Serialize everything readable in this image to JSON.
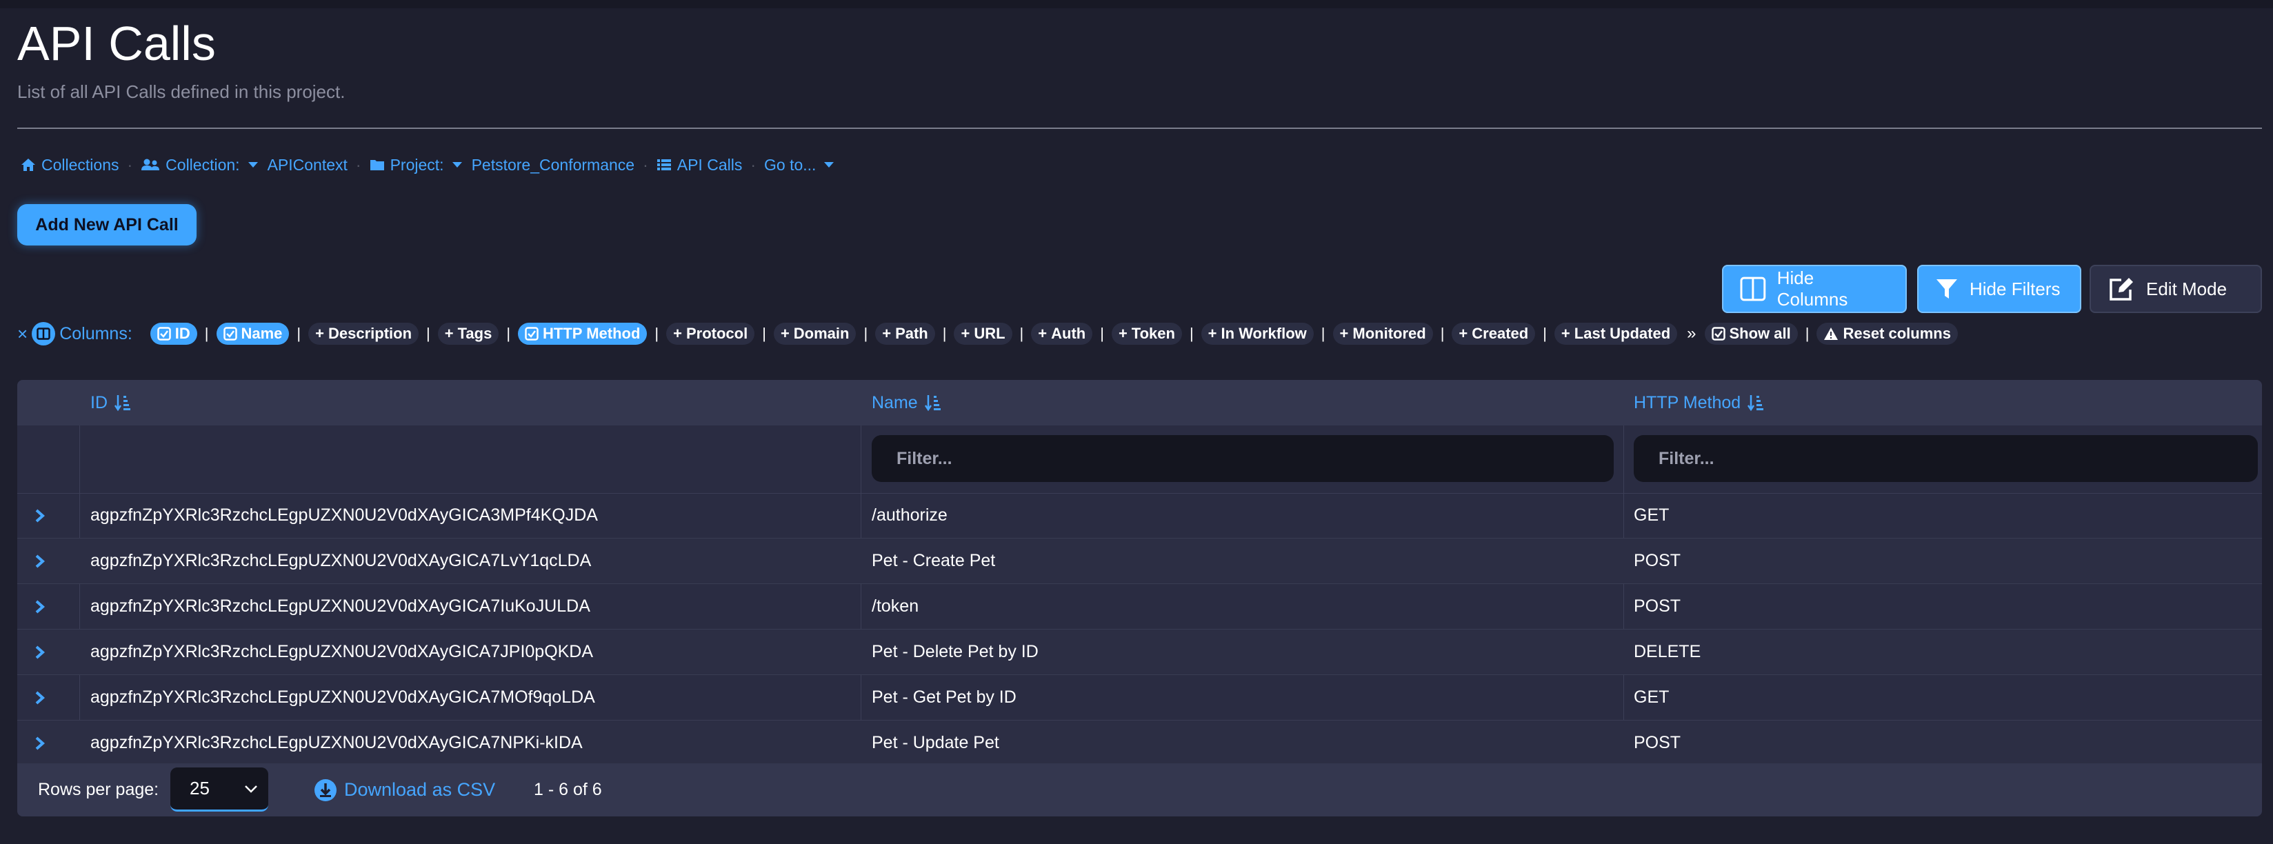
{
  "page": {
    "title": "API Calls",
    "subtitle": "List of all API Calls defined in this project."
  },
  "breadcrumb": {
    "collections": "Collections",
    "collection_label": "Collection:",
    "collection_value": "APIContext",
    "project_label": "Project:",
    "project_value": "Petstore_Conformance",
    "api_calls": "API Calls",
    "goto": "Go to..."
  },
  "actions": {
    "add_new": "Add New API Call",
    "hide_columns": "Hide Columns",
    "hide_filters": "Hide Filters",
    "edit_mode": "Edit Mode"
  },
  "columns_bar": {
    "close": "×",
    "label": "Columns:",
    "active": [
      "ID",
      "Name"
    ],
    "active2": [
      "HTTP Method"
    ],
    "inactive_a": [
      "Description",
      "Tags"
    ],
    "inactive_b": [
      "Protocol",
      "Domain",
      "Path",
      "URL",
      "Auth",
      "Token",
      "In Workflow",
      "Monitored",
      "Created",
      "Last Updated"
    ],
    "show_all": "Show all",
    "reset": "Reset columns",
    "more": "»"
  },
  "table": {
    "headers": [
      "ID",
      "Name",
      "HTTP Method"
    ],
    "filter_placeholder": "Filter...",
    "rows": [
      {
        "id": "agpzfnZpYXRlc3RzchcLEgpUZXN0U2V0dXAyGICA3MPf4KQJDA",
        "name": "/authorize",
        "method": "GET"
      },
      {
        "id": "agpzfnZpYXRlc3RzchcLEgpUZXN0U2V0dXAyGICA7LvY1qcLDA",
        "name": "Pet - Create Pet",
        "method": "POST"
      },
      {
        "id": "agpzfnZpYXRlc3RzchcLEgpUZXN0U2V0dXAyGICA7IuKoJULDA",
        "name": "/token",
        "method": "POST"
      },
      {
        "id": "agpzfnZpYXRlc3RzchcLEgpUZXN0U2V0dXAyGICA7JPI0pQKDA",
        "name": "Pet - Delete Pet by ID",
        "method": "DELETE"
      },
      {
        "id": "agpzfnZpYXRlc3RzchcLEgpUZXN0U2V0dXAyGICA7MOf9qoLDA",
        "name": "Pet - Get Pet by ID",
        "method": "GET"
      },
      {
        "id": "agpzfnZpYXRlc3RzchcLEgpUZXN0U2V0dXAyGICA7NPKi-kIDA",
        "name": "Pet - Update Pet",
        "method": "POST"
      }
    ]
  },
  "footer": {
    "rows_per_page_label": "Rows per page:",
    "rows_per_page_value": "25",
    "download": "Download as CSV",
    "range": "1 - 6 of 6"
  },
  "colors": {
    "background": "#1e1f2e",
    "accent": "#3fa5ff",
    "link": "#46a6ff"
  }
}
